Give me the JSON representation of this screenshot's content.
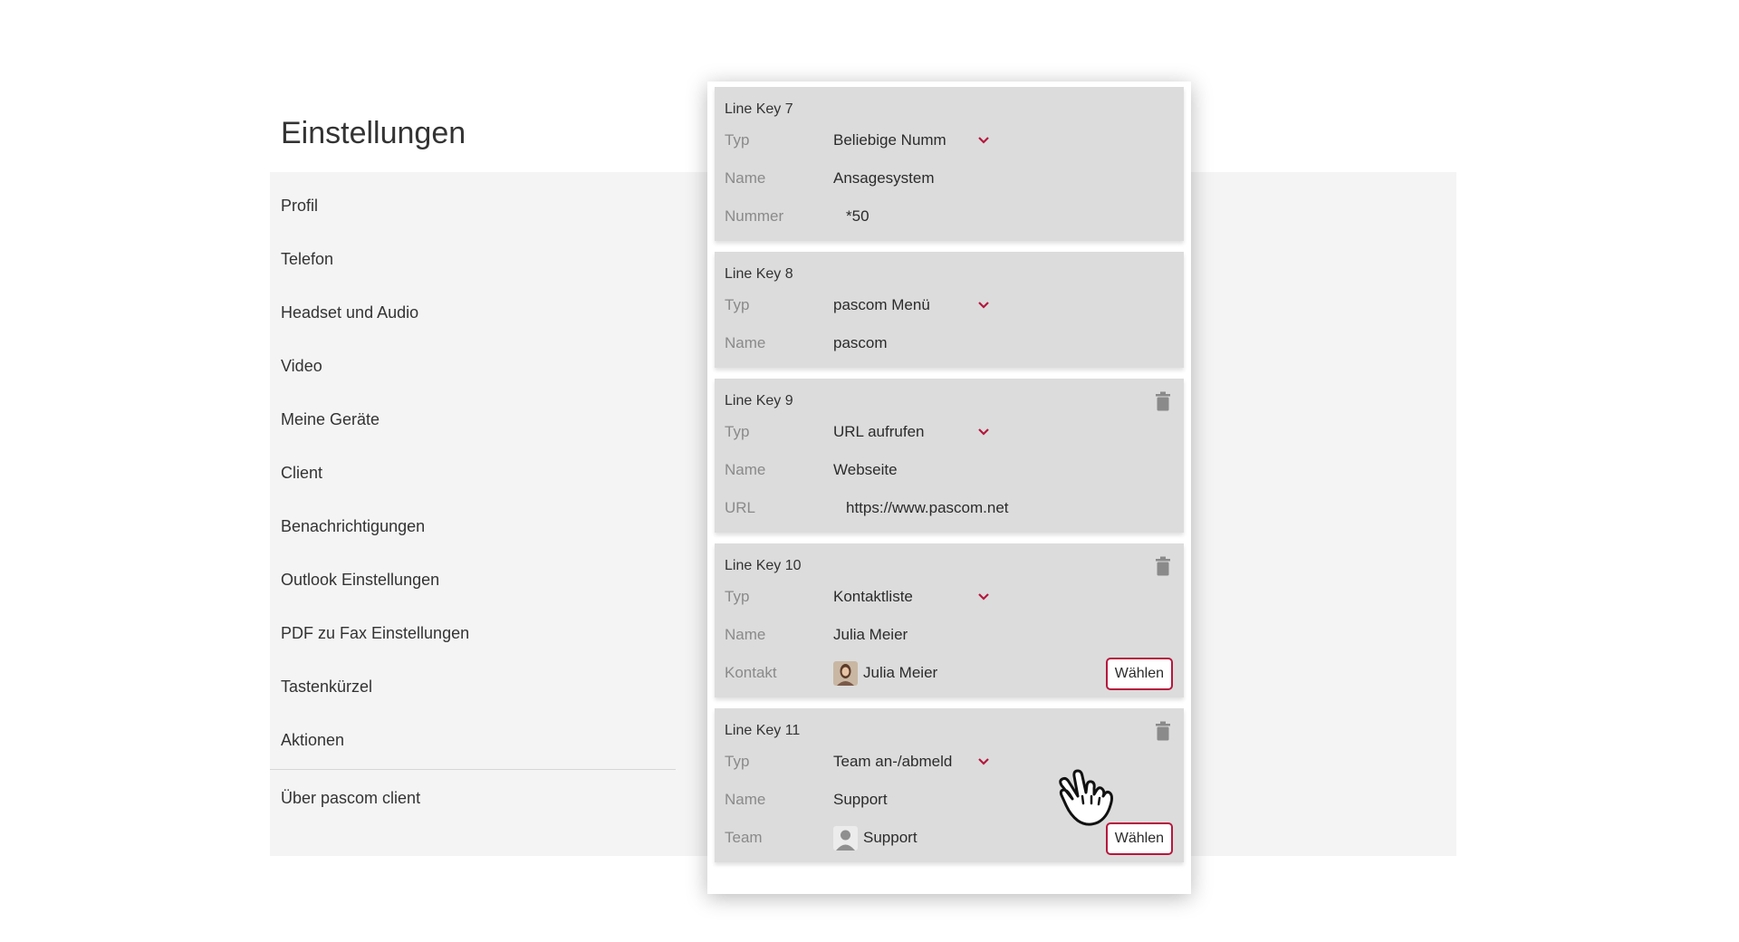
{
  "settings": {
    "title": "Einstellungen",
    "nav": [
      {
        "label": "Profil"
      },
      {
        "label": "Telefon"
      },
      {
        "label": "Headset und Audio"
      },
      {
        "label": "Video"
      },
      {
        "label": "Meine Geräte"
      },
      {
        "label": "Client"
      },
      {
        "label": "Benachrichtigungen"
      },
      {
        "label": "Outlook Einstellungen"
      },
      {
        "label": "PDF zu Fax Einstellungen"
      },
      {
        "label": "Tastenkürzel"
      },
      {
        "label": "Aktionen"
      }
    ],
    "nav_footer": {
      "label": "Über pascom client"
    }
  },
  "line_keys": [
    {
      "title": "Line Key 7",
      "type_label": "Typ",
      "type_value": "Beliebige Numm",
      "name_label": "Name",
      "name_value": "Ansagesystem",
      "extra_label": "Nummer",
      "extra_value": "*50"
    },
    {
      "title": "Line Key 8",
      "type_label": "Typ",
      "type_value": "pascom Menü",
      "name_label": "Name",
      "name_value": "pascom"
    },
    {
      "title": "Line Key 9",
      "type_label": "Typ",
      "type_value": "URL aufrufen",
      "name_label": "Name",
      "name_value": "Webseite",
      "extra_label": "URL",
      "extra_value": "https://www.pascom.net"
    },
    {
      "title": "Line Key 10",
      "type_label": "Typ",
      "type_value": "Kontaktliste",
      "name_label": "Name",
      "name_value": "Julia Meier",
      "extra_label": "Kontakt",
      "extra_value": "Julia Meier",
      "button_label": "Wählen"
    },
    {
      "title": "Line Key 11",
      "type_label": "Typ",
      "type_value": "Team an-/abmeld",
      "name_label": "Name",
      "name_value": "Support",
      "extra_label": "Team",
      "extra_value": "Support",
      "button_label": "Wählen"
    }
  ],
  "icons": {
    "chevron": "chevron-down-icon",
    "trash": "trash-icon",
    "cursor": "hand-pointer-icon"
  },
  "colors": {
    "accent": "#b5173d",
    "card_bg": "#dcdcdc",
    "panel_bg": "#f4f4f4"
  }
}
